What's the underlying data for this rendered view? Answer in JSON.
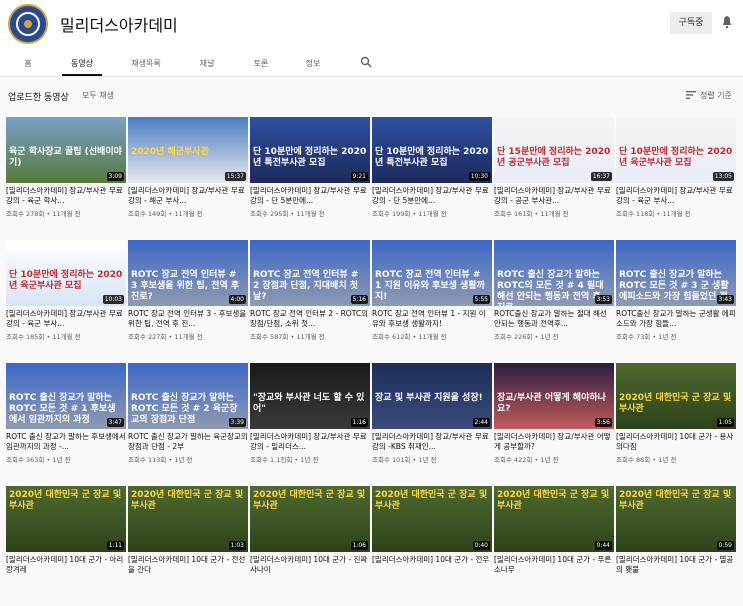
{
  "channel": {
    "name": "밀리더스아카데미",
    "subscribe_label": "구독중"
  },
  "tabs": [
    "홈",
    "동영상",
    "재생목록",
    "채널",
    "토론",
    "정보"
  ],
  "section": {
    "title": "업로드한 동영상",
    "play_all": "모두 재생",
    "sort_label": "정렬 기준"
  },
  "videos": [
    {
      "overlay": "육군 학사장교 꿀팁 (선배이야기)",
      "duration": "3:09",
      "title": "[밀리더스아카데미] 장교/부사관 무료 강의 - 육군 학사...",
      "meta": "조회수 278회 • 11개월 전"
    },
    {
      "overlay": "2020년 해군부사관",
      "duration": "15:37",
      "title": "[밀리더스아카데미] 장교/부사관 무료 강의 - 해군 부사...",
      "meta": "조회수 149회 • 11개월 전"
    },
    {
      "overlay": "단 10분만에 정리하는 2020년 특전부사관 모집",
      "duration": "9:21",
      "title": "[밀리더스아카데미] 장교/부사관 무료 강의 - 단 5분만에...",
      "meta": "조회수 295회 • 11개월 전"
    },
    {
      "overlay": "단 10분만에 정리하는 2020년 특전부사관 모집",
      "duration": "10:30",
      "title": "[밀리더스아카데미] 장교/부사관 무료 강의 - 단 5분만에...",
      "meta": "조회수 199회 • 11개월 전"
    },
    {
      "overlay": "단 15분만에 정리하는 2020년 공군부사관 모집",
      "duration": "16:37",
      "title": "[밀리더스아카데미] 장교/부사관 무료 강의 - 공군 부사관...",
      "meta": "조회수 161회 • 11개월 전"
    },
    {
      "overlay": "단 10분만에 정리하는 2020년 육군부사관 모집",
      "duration": "13:05",
      "title": "[밀리더스아카데미] 장교/부사관 무료 강의 - 육군 부사...",
      "meta": "조회수 118회 • 11개월 전"
    },
    {
      "overlay": "단 10분만에 정리하는 2020년 육군부사관 모집",
      "duration": "10:03",
      "title": "[밀리더스아카데미] 장교/부사관 무료 강의 - 육군 부사...",
      "meta": "조회수 185회 • 11개월 전"
    },
    {
      "overlay": "ROTC 장교 전역 인터뷰 # 3 후보생을 위한 팁, 전역 후 진로?",
      "duration": "4:00",
      "title": "ROTC 장교 전역 인터뷰 3 - 후보생을 위한 팁, 전역 후 진...",
      "meta": "조회수 227회 • 11개월 전"
    },
    {
      "overlay": "ROTC 장교 전역 인터뷰 # 2 장점과 단점, 지대배치 첫날?",
      "duration": "5:16",
      "title": "ROTC 장교 전역 인터뷰 2 - ROTC의 장점/단점, 소위 첫...",
      "meta": "조회수 587회 • 11개월 전"
    },
    {
      "overlay": "ROTC 장교 전역 인터뷰 # 1 지원 이유와 후보생 생활까지!",
      "duration": "5:55",
      "title": "ROTC 장교 전역 인터뷰 1 - 지원 이유와 후보생 생활까지!",
      "meta": "조회수 612회 • 11개월 전"
    },
    {
      "overlay": "ROTC 출신 장교가 말하는 ROTC의 모든 것 # 4 필대 해선 안되는 행동과 전역 후 진로",
      "duration": "3:53",
      "title": "ROTC출신 장교가 말하는 절대 해선 안되는 행동과 전역후...",
      "meta": "조회수 226회 • 1년 전"
    },
    {
      "overlay": "ROTC 출신 장교가 말하는 ROTC 모든 것 # 3 군 생활 에피소드와 가장 힘들었던 점",
      "duration": "3:43",
      "title": "ROTC출신 장교가 말하는 군생활 에피소드와 가장 힘들...",
      "meta": "조회수 73회 • 1년 전"
    },
    {
      "overlay": "ROTC 출신 장교가 말하는 ROTC 모든 것 # 1 후보생에서 임관까지의 과정",
      "duration": "3:47",
      "title": "ROTC 출신 장교가 말하는 후보생에서 임관까지의 과정 -...",
      "meta": "조회수 363회 • 1년 전"
    },
    {
      "overlay": "ROTC 출신 장교가 말하는 ROTC 모든 것 # 2 육군장교의 장점과 단점",
      "duration": "3:39",
      "title": "ROTC 출신 장교가 말하는 육군장교의 장점과 단점 - 2부",
      "meta": "조회수 113회 • 1년 전"
    },
    {
      "overlay": "\"장교와 부사관 너도 할 수 있어\"",
      "duration": "1:16",
      "title": "[밀리더스아카데미] 장교/부사관 무료 강의 - 밀리더스...",
      "meta": "조회수 1.1천회 • 1년 전"
    },
    {
      "overlay": "장교 및 부사관 지원을 성장!",
      "duration": "2:44",
      "title": "[밀리더스아카데미] 장교/부사관 무료 강의 -KBS 취재인...",
      "meta": "조회수 101회 • 1년 전"
    },
    {
      "overlay": "장교/부사관 어떻게 해야하나요?",
      "duration": "3:56",
      "title": "[밀리더스아카데미] 장교/부사관 어떻게 공부할까?",
      "meta": "조회수 422회 • 1년 전"
    },
    {
      "overlay": "2020년 대한민국 군 장교 및 부사관",
      "duration": "1:05",
      "title": "[밀리더스아카데미] 10대 군가 - 용사의다짐",
      "meta": "조회수 88회 • 1년 전"
    },
    {
      "overlay": "2020년 대한민국 군 장교 및 부사관",
      "duration": "1:11",
      "title": "[밀리더스아카데미] 10대 군가 - 아리랑겨레",
      "meta": ""
    },
    {
      "overlay": "2020년 대한민국 군 장교 및 부사관",
      "duration": "1:03",
      "title": "[밀리더스아카데미] 10대 군가 - 전선을 간다",
      "meta": ""
    },
    {
      "overlay": "2020년 대한민국 군 장교 및 부사관",
      "duration": "1:06",
      "title": "[밀리더스아카데미] 10대 군가 - 진짜 사나이",
      "meta": ""
    },
    {
      "overlay": "2020년 대한민국 군 장교 및 부사관",
      "duration": "0:40",
      "title": "[밀리더스아카데미] 10대 군가 - 전우",
      "meta": ""
    },
    {
      "overlay": "2020년 대한민국 군 장교 및 부사관",
      "duration": "0:44",
      "title": "[밀리더스아카데미] 10대 군가 - 푸른 소나무",
      "meta": ""
    },
    {
      "overlay": "2020년 대한민국 군 장교 및 부사관",
      "duration": "0:59",
      "title": "[밀리더스아카데미] 10대 군가 - 멸공의 횃불",
      "meta": ""
    }
  ]
}
